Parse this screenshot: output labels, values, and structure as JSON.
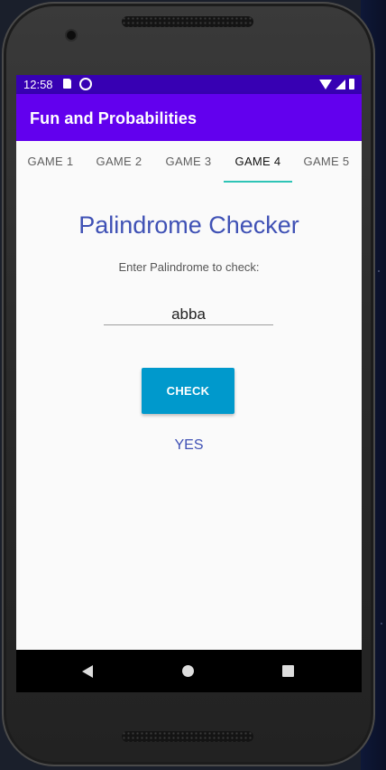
{
  "status_bar": {
    "time": "12:58"
  },
  "app_bar": {
    "title": "Fun and Probabilities"
  },
  "tabs": [
    {
      "label": "GAME 1",
      "active": false
    },
    {
      "label": "GAME 2",
      "active": false
    },
    {
      "label": "GAME 3",
      "active": false
    },
    {
      "label": "GAME 4",
      "active": true
    },
    {
      "label": "GAME 5",
      "active": false
    }
  ],
  "main": {
    "title": "Palindrome Checker",
    "prompt": "Enter Palindrome to check:",
    "input_value": "abba",
    "check_label": "CHECK",
    "result": "YES"
  },
  "colors": {
    "status_bar": "#3700b3",
    "app_bar": "#6200ee",
    "tab_indicator": "#2ec4b6",
    "title_text": "#3f51b5",
    "check_button": "#0099cc"
  },
  "icons": {
    "status": [
      "sd-card-icon",
      "sync-icon",
      "wifi-icon",
      "signal-icon",
      "battery-icon"
    ],
    "navigation": [
      "back-icon",
      "home-icon",
      "recents-icon"
    ]
  }
}
